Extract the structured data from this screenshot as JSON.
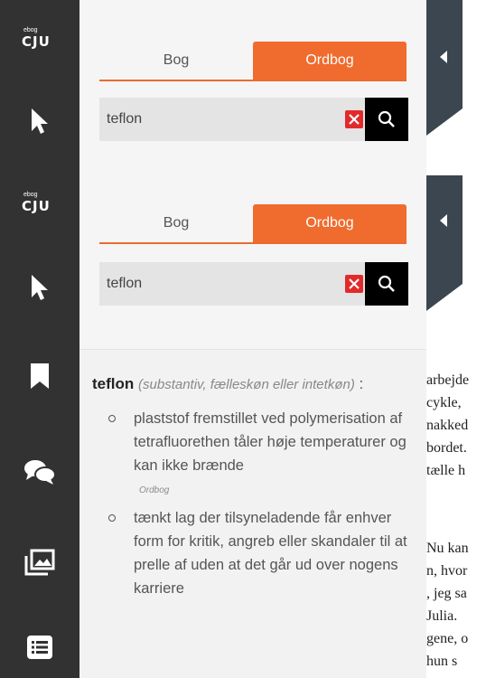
{
  "toolbar": {
    "logo_small": "ebog",
    "logo_big": "CJU",
    "icons": [
      "pointer-icon",
      "bookmark-icon",
      "comments-icon",
      "images-icon",
      "list-icon"
    ]
  },
  "panel_top": {
    "tabs": [
      "Bog",
      "Ordbog"
    ],
    "active_tab": "Ordbog",
    "search_value": "teflon"
  },
  "panel_bottom": {
    "tabs": [
      "Bog",
      "Ordbog"
    ],
    "active_tab": "Ordbog",
    "search_value": "teflon"
  },
  "entry": {
    "word": "teflon",
    "grammar": "(substantiv, fælleskøn eller intetkøn)",
    "colon": " :",
    "senses": [
      "plaststof fremstillet ved polymerisation af tetrafluorethen tåler høje temperaturer og kan ikke brænde",
      "tænkt lag der tilsyneladende får enhver form for kritik, angreb eller skandaler til at prelle af uden at det går ud over nogens karriere"
    ],
    "source": "Ordbog"
  },
  "book_lines": {
    "block1": [
      "arbejde",
      "cykle,",
      "nakked",
      "bordet.",
      "tælle h"
    ],
    "block2": [
      "Nu kan",
      "n, hvor",
      ", jeg sa",
      "Julia.",
      "gene, o",
      "hun s"
    ]
  },
  "colors": {
    "accent": "#f06b2e",
    "toolbar": "#323232",
    "flap": "#3b4650",
    "clear": "#e22a2a"
  }
}
